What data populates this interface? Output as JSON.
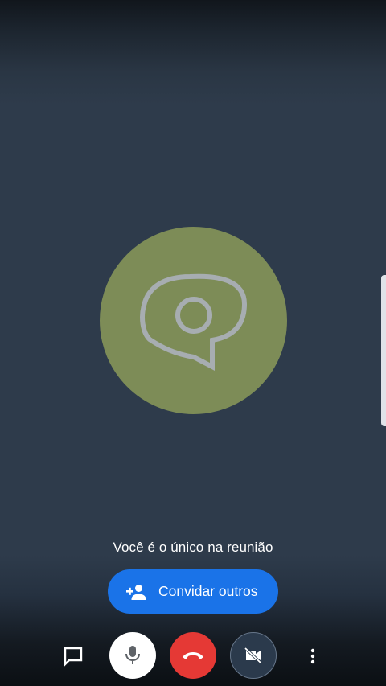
{
  "meeting": {
    "status_text": "Você é o único na reunião",
    "invite_label": "Convidar outros"
  },
  "icons": {
    "avatar": "speech-bubble-ring-icon",
    "invite": "person-add-icon",
    "chat": "chat-bubble-icon",
    "mic": "microphone-icon",
    "hangup": "phone-hangup-icon",
    "camera": "camera-off-icon",
    "more": "more-vert-icon"
  },
  "colors": {
    "background": "#2e3b4b",
    "avatar": "#7d8c57",
    "avatar_glyph": "#a7adb1",
    "invite_button": "#1a73e8",
    "hangup_button": "#e53935",
    "camera_button": "#2b3a4c",
    "mic_button": "#ffffff",
    "text": "#ffffff"
  }
}
